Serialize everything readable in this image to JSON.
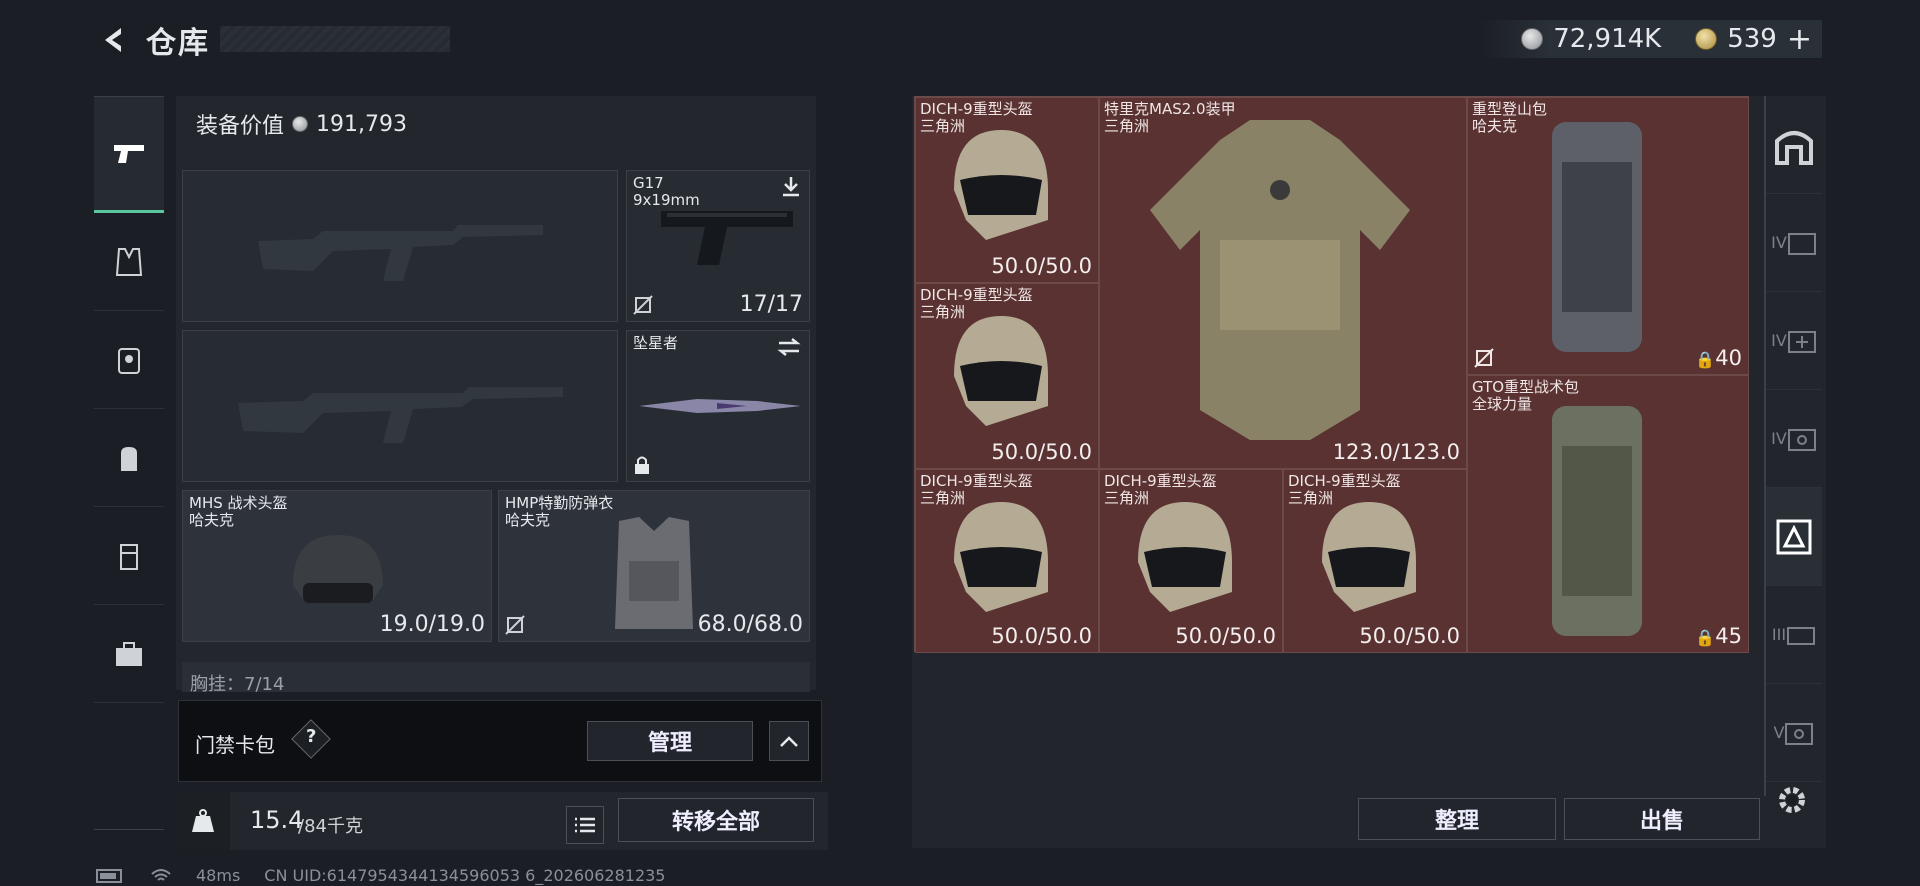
{
  "header": {
    "title": "仓库",
    "currency_silver": "72,914K",
    "currency_gold": "539",
    "add_symbol": "+"
  },
  "left": {
    "equip_value_label": "装备价值",
    "equip_value": "191,793",
    "pistol": {
      "name": "G17",
      "caliber": "9x19mm",
      "ammo": "17/17"
    },
    "melee": {
      "name": "坠星者"
    },
    "helmet": {
      "name": "MHS 战术头盔",
      "maker": "哈夫克",
      "durability": "19.0/19.0"
    },
    "armor": {
      "name": "HMP特勤防弹衣",
      "maker": "哈夫克",
      "durability": "68.0/68.0"
    },
    "chest_partial": "胸挂：7/14",
    "cardpack": {
      "label": "门禁卡包",
      "help": "?",
      "manage_label": "管理"
    },
    "weight": {
      "current": "15.4",
      "max": "/84千克"
    },
    "transfer_label": "转移全部"
  },
  "stash": {
    "items": [
      {
        "name": "DICH-9重型头盔",
        "maker": "三角洲",
        "durability": "50.0/50.0"
      },
      {
        "name": "特里克MAS2.0装甲",
        "maker": "三角洲",
        "durability": "123.0/123.0"
      },
      {
        "name": "重型登山包",
        "maker": "哈夫克",
        "capacity": "40"
      },
      {
        "name": "DICH-9重型头盔",
        "maker": "三角洲",
        "durability": "50.0/50.0"
      },
      {
        "name": "GTO重型战术包",
        "maker": "全球力量",
        "capacity": "45"
      },
      {
        "name": "DICH-9重型头盔",
        "maker": "三角洲",
        "durability": "50.0/50.0"
      },
      {
        "name": "DICH-9重型头盔",
        "maker": "三角洲",
        "durability": "50.0/50.0"
      },
      {
        "name": "DICH-9重型头盔",
        "maker": "三角洲",
        "durability": "50.0/50.0"
      }
    ],
    "sort_label": "整理",
    "sell_label": "出售"
  },
  "right_tabs": [
    "I",
    "II",
    "III",
    "IV",
    "V"
  ],
  "status": {
    "ping": "48ms",
    "uid": "CN UID:6147954344134596053 6_202606281235"
  },
  "colors": {
    "accent": "#5bc79f",
    "stash_bg": "#5a3232"
  }
}
